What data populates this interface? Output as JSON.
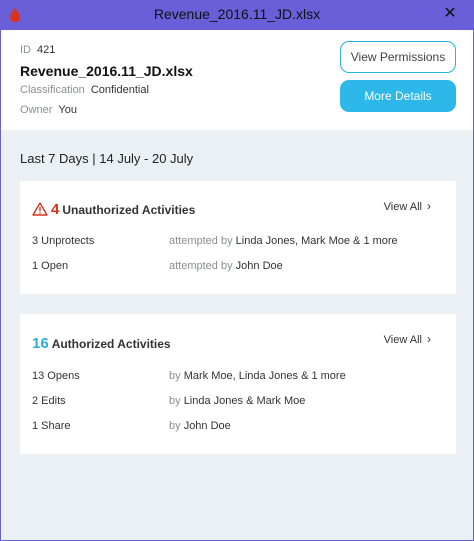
{
  "window": {
    "title": "Revenue_2016.11_JD.xlsx",
    "close_glyph": "✕",
    "app_icon": "drop-icon",
    "accent": "#6a5fd8"
  },
  "header": {
    "id_label": "ID",
    "id_value": "421",
    "file_name": "Revenue_2016.11_JD.xlsx",
    "classification_label": "Classification",
    "classification_value": "Confidential",
    "owner_label": "Owner",
    "owner_value": "You",
    "view_permissions_label": "View Permissions",
    "more_details_label": "More Details"
  },
  "period": "Last 7 Days | 14 July - 20 July",
  "unauthorized": {
    "count": "4",
    "title": "Unauthorized Activities",
    "view_all": "View All",
    "color": "#d9321e",
    "rows": [
      {
        "activity": "3 Unprotects",
        "prefix": "attempted by",
        "names": "Linda Jones, Mark Moe & 1 more"
      },
      {
        "activity": "1 Open",
        "prefix": "attempted by",
        "names": "John Doe"
      }
    ]
  },
  "authorized": {
    "count": "16",
    "title": "Authorized Activities",
    "view_all": "View All",
    "color": "#27aee0",
    "rows": [
      {
        "activity": "13 Opens",
        "prefix": "by",
        "names": "Mark Moe, Linda Jones & 1 more"
      },
      {
        "activity": "2 Edits",
        "prefix": "by",
        "names": "Linda Jones & Mark Moe"
      },
      {
        "activity": "1 Share",
        "prefix": "by",
        "names": "John Doe"
      }
    ]
  }
}
